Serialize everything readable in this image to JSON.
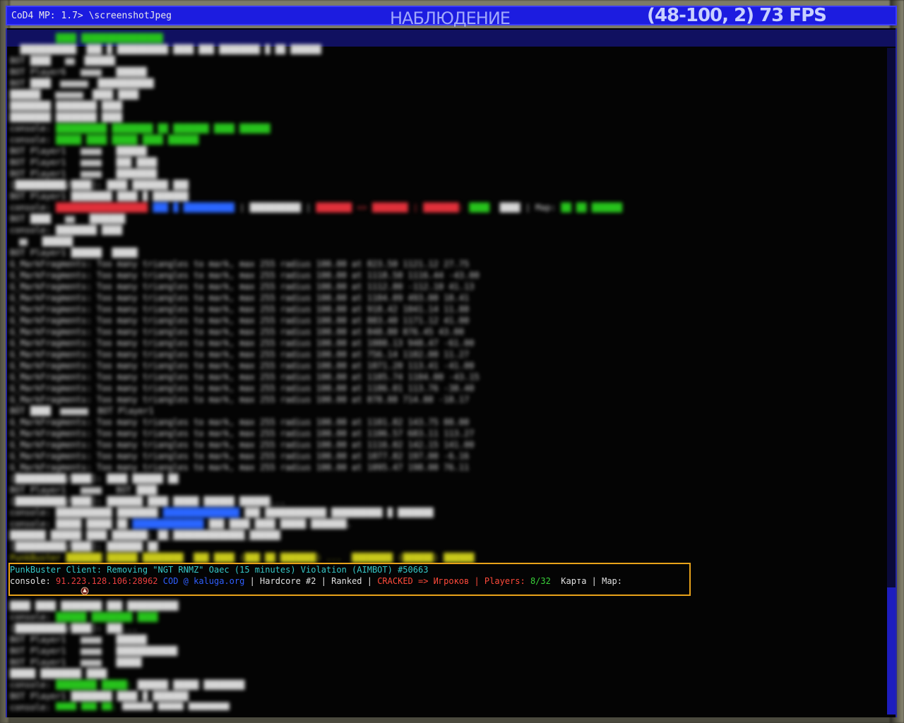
{
  "console_input": {
    "prompt": "CoD4 MP: 1.7>",
    "command": "\\screenshotJpeg"
  },
  "hud": {
    "observer_label": "НАБЛЮДЕНИЕ",
    "fps_readout": "(48-100, 2) 73 FPS"
  },
  "highlighted_log": {
    "line1": "PunkBuster Client: Removing \"NGT RNMZ\" Oaec (15 minutes) Violation (AIMBOT) #50663",
    "line2": {
      "prefix": "console: ",
      "ip": "91.223.128.106:28962",
      "cod": " COD @ ",
      "site": "kaluga.org",
      "sep1": " | Hardcore #2 | Ranked | ",
      "cracked": "CRACKED => Игроков | Players: ",
      "players": "8/32",
      "tail": "  Карта | Map:"
    }
  },
  "colors": {
    "input_bar": "#1c1ce0",
    "highlight_border": "#e8a21a",
    "punkbuster_text": "#22c8c8"
  },
  "icons": [
    "cursor-icon",
    "player-avatar-icon",
    "weapon-icon"
  ]
}
